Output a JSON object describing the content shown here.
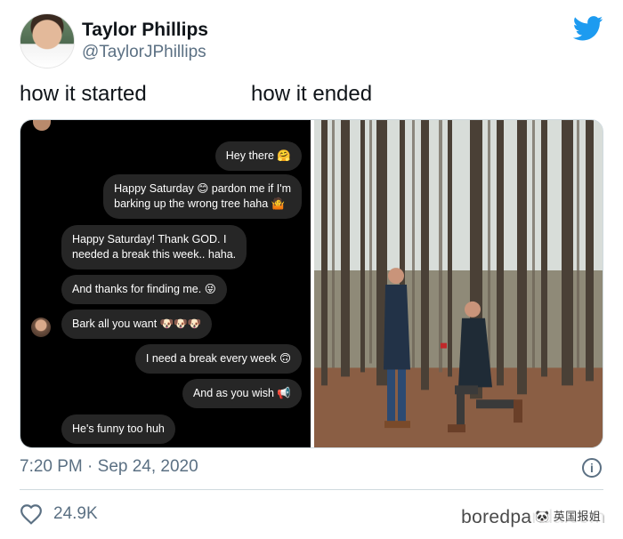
{
  "tweet": {
    "author_name": "Taylor Phillips",
    "author_handle": "@TaylorJPhillips",
    "caption_left": "how it started",
    "caption_right": "how it ended",
    "timestamp": "7:20 PM · Sep 24, 2020",
    "like_count": "24.9K",
    "info_glyph": "i"
  },
  "chat": {
    "messages": [
      {
        "side": "right",
        "text": "Hey there 🤗"
      },
      {
        "side": "right",
        "text": "Happy Saturday 😊 pardon me if I'm\nbarking up the wrong tree haha 🤷"
      },
      {
        "side": "left",
        "text": "Happy Saturday! Thank GOD. I\nneeded a break this week.. haha."
      },
      {
        "side": "left",
        "text": "And thanks for finding me. 😜"
      },
      {
        "side": "left",
        "text": "Bark all you want 🐶🐶🐶"
      },
      {
        "side": "right",
        "text": "I need a break every week 🙃"
      },
      {
        "side": "right",
        "text": "And as you wish 📢"
      },
      {
        "side": "left",
        "text": "He's funny too huh"
      }
    ]
  },
  "watermark": {
    "site": "boredpanda.com",
    "overlay": "🐼 英国报姐"
  },
  "colors": {
    "twitter_blue": "#1d9bf0",
    "secondary_text": "#5b7083",
    "chat_bubble": "#262626",
    "chat_bg": "#000000"
  },
  "icons": [
    "twitter-bird-icon",
    "info-icon",
    "heart-icon"
  ]
}
